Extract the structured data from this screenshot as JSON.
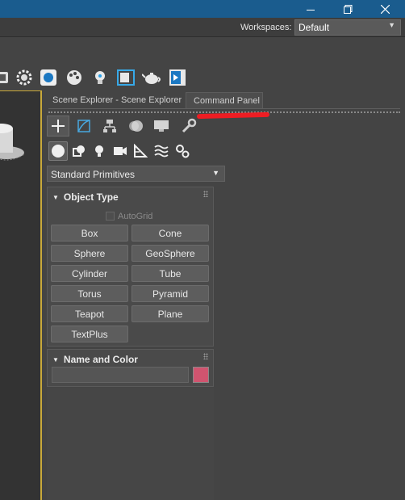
{
  "window": {
    "controls": [
      {
        "icon": "minimize-icon"
      },
      {
        "icon": "maximize-icon"
      },
      {
        "icon": "close-icon"
      }
    ]
  },
  "workspaces": {
    "label": "Workspaces:",
    "value": "Default"
  },
  "main_toolbar": {
    "icons": [
      "teapot-render-icon",
      "gear-setup-icon",
      "render-frame-icon",
      "material-palette-icon",
      "light-bulb-icon",
      "viewport-window-icon",
      "teapot-icon",
      "play-render-icon"
    ]
  },
  "panel_tabs": [
    {
      "label": "Scene Explorer - Scene Explorer",
      "active": false
    },
    {
      "label": "Command Panel",
      "active": true
    }
  ],
  "command_tabs": [
    "create-icon",
    "modify-icon",
    "hierarchy-icon",
    "motion-icon",
    "display-icon",
    "utilities-icon"
  ],
  "categories": [
    "geometry-icon",
    "shapes-icon",
    "lights-icon",
    "cameras-icon",
    "helpers-icon",
    "space-warps-icon",
    "systems-icon"
  ],
  "subcategory": {
    "value": "Standard Primitives"
  },
  "object_type": {
    "title": "Object Type",
    "autogrid": "AutoGrid",
    "buttons": [
      "Box",
      "Cone",
      "Sphere",
      "GeoSphere",
      "Cylinder",
      "Tube",
      "Torus",
      "Pyramid",
      "Teapot",
      "Plane",
      "TextPlus"
    ]
  },
  "name_and_color": {
    "title": "Name and Color",
    "name_value": "",
    "color": "#d0546f"
  },
  "colors": {
    "title_bar": "#1a5c8e",
    "panel_bg": "#444444",
    "annotation": "#ee1d23",
    "viewport_border": "#c9a93a"
  }
}
